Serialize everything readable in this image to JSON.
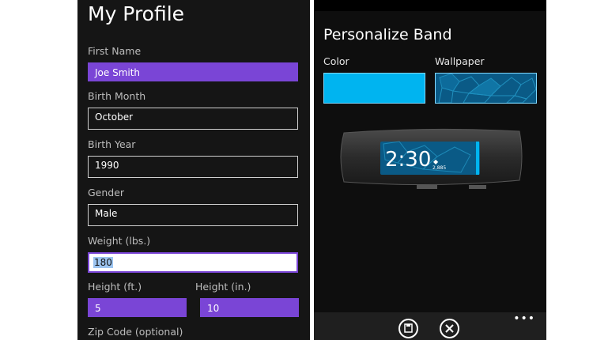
{
  "profile": {
    "title": "My Profile",
    "first_name_label": "First Name",
    "first_name_value": "Joe Smith",
    "birth_month_label": "Birth Month",
    "birth_month_value": "October",
    "birth_year_label": "Birth Year",
    "birth_year_value": "1990",
    "gender_label": "Gender",
    "gender_value": "Male",
    "weight_label": "Weight (lbs.)",
    "weight_value": "180",
    "height_ft_label": "Height (ft.)",
    "height_ft_value": "5",
    "height_in_label": "Height (in.)",
    "height_in_value": "10",
    "zip_label": "Zip Code (optional)"
  },
  "band": {
    "title": "Personalize Band",
    "color_label": "Color",
    "wallpaper_label": "Wallpaper",
    "selected_color": "#00b4f0",
    "time": "2:30",
    "steps": "2,885",
    "appbar": {
      "save_icon": "save-icon",
      "cancel_icon": "cancel-icon",
      "more": "•••"
    }
  },
  "colors": {
    "accent_purple": "#7a45d6",
    "background": "#151515"
  }
}
